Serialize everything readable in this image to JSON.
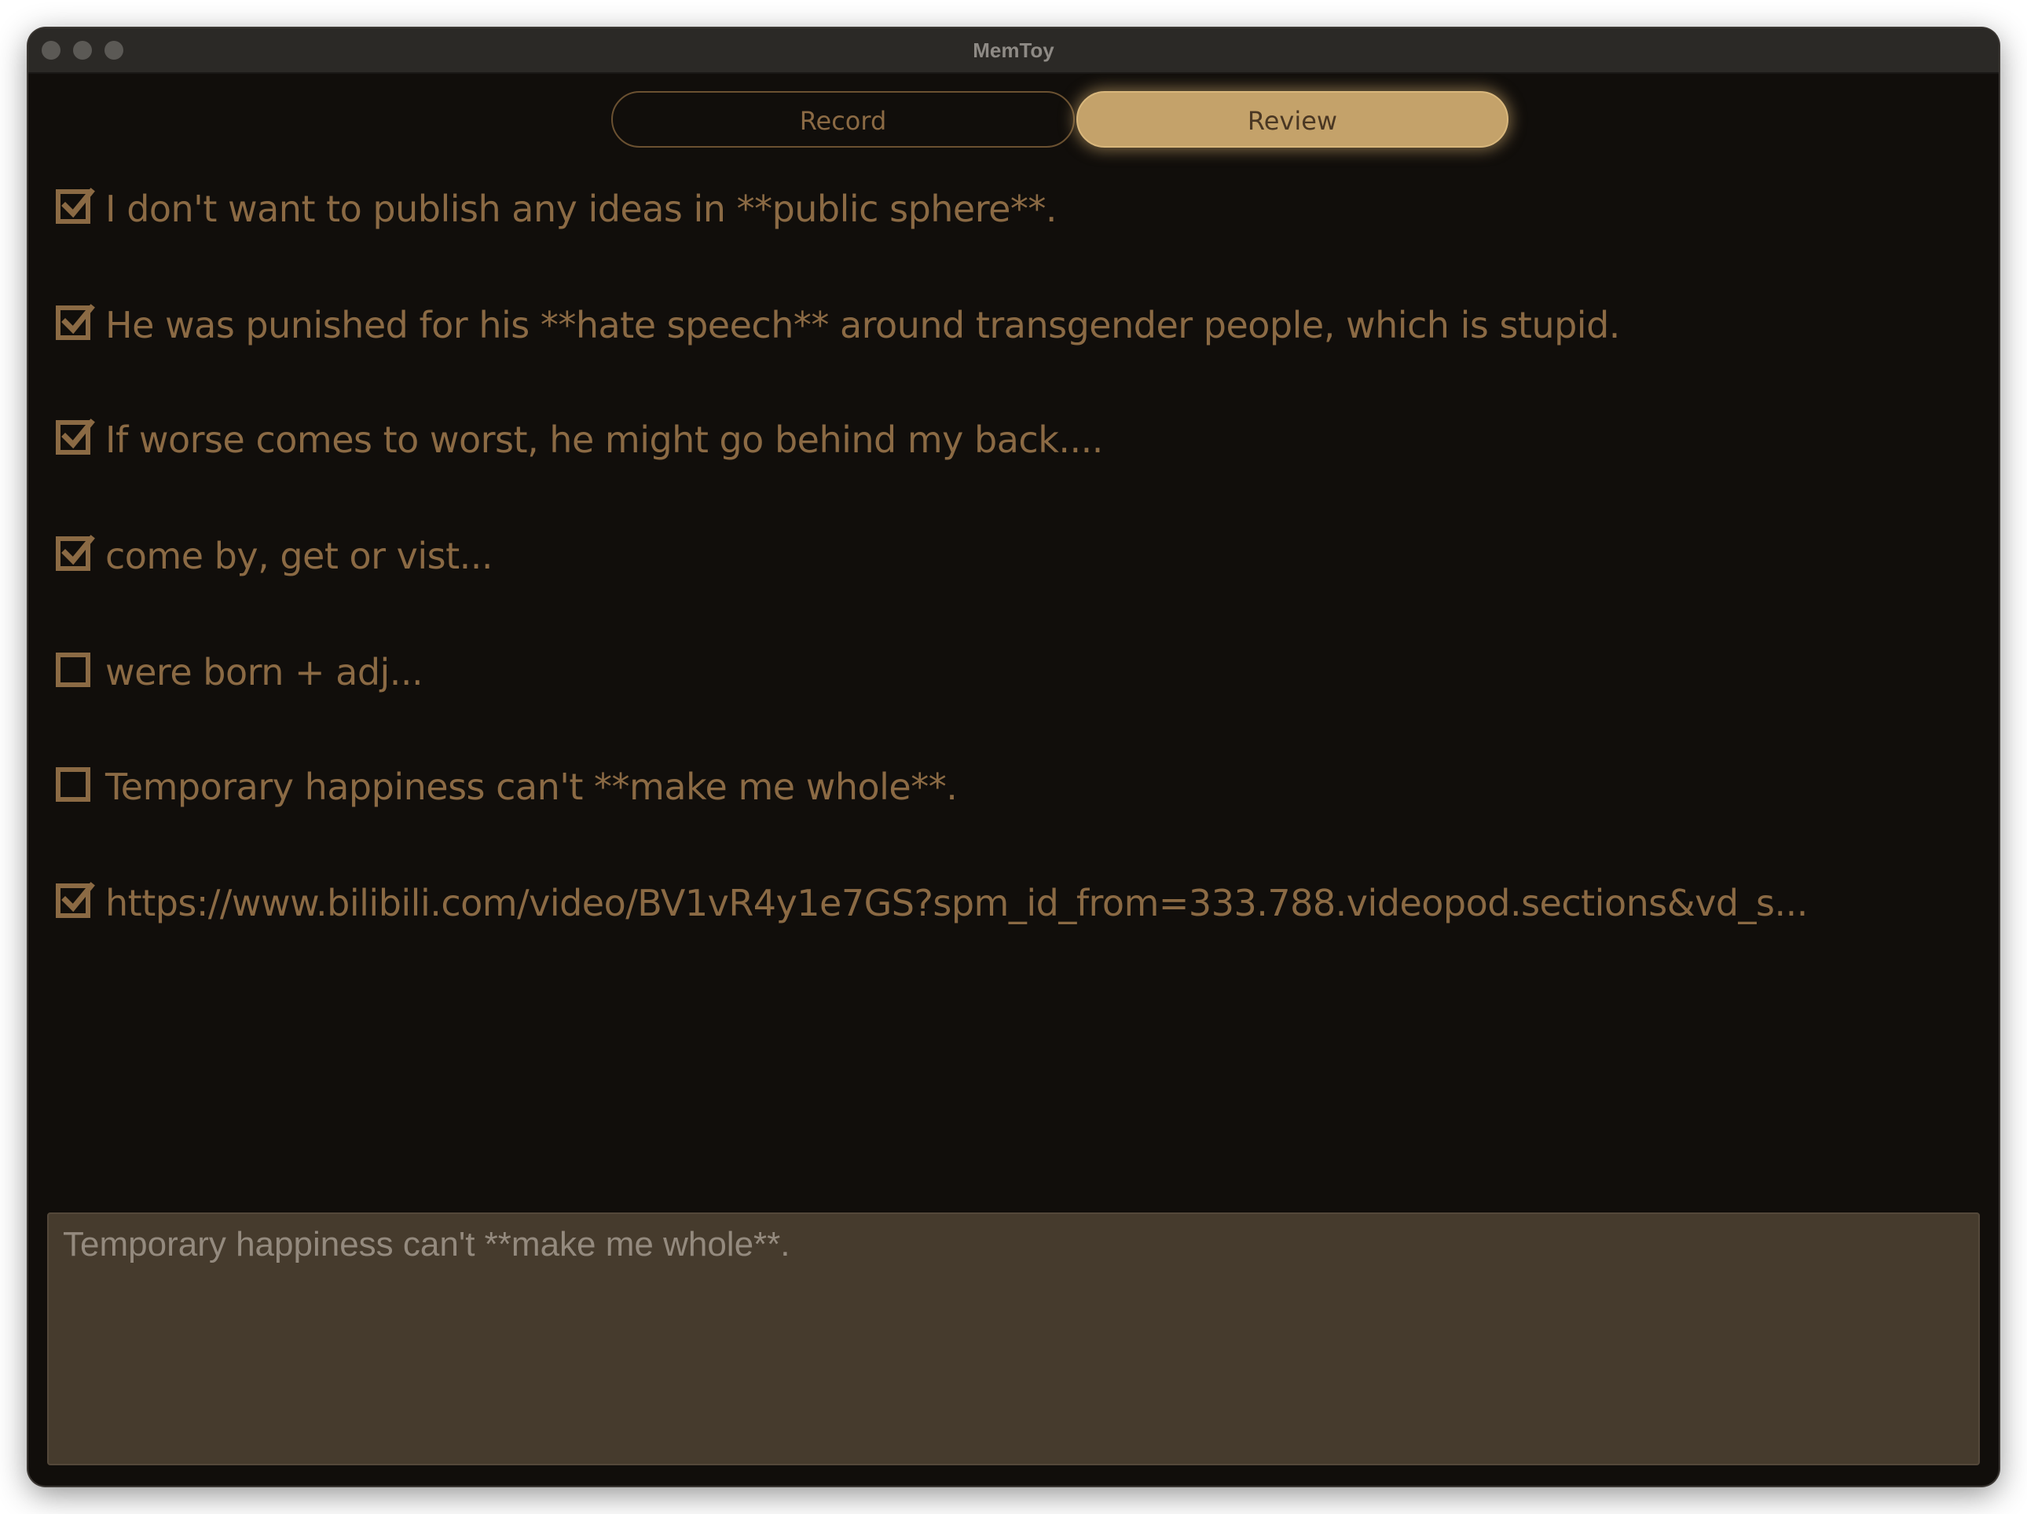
{
  "window": {
    "title": "MemToy"
  },
  "tabs": [
    {
      "label": "Record",
      "active": false
    },
    {
      "label": "Review",
      "active": true
    }
  ],
  "items": [
    {
      "text": "I don't want to publish any ideas in **public sphere**.",
      "checked": true
    },
    {
      "text": "He was punished for his **hate speech** around transgender people, which is stupid.",
      "checked": true
    },
    {
      "text": "If worse comes to worst, he might go behind my back....",
      "checked": true
    },
    {
      "text": "come by, get or vist...",
      "checked": true
    },
    {
      "text": "were born + adj...",
      "checked": false
    },
    {
      "text": "Temporary happiness can't **make me whole**.",
      "checked": false
    },
    {
      "text": "https://www.bilibili.com/video/BV1vR4y1e7GS?spm_id_from=333.788.videopod.sections&vd_s...",
      "checked": true
    }
  ],
  "editor": {
    "value": "Temporary happiness can't **make me whole**."
  },
  "colors": {
    "background": "#110e0b",
    "accent": "#c4a26a",
    "text": "#8b6a44",
    "editor_bg": "#463b2d"
  }
}
